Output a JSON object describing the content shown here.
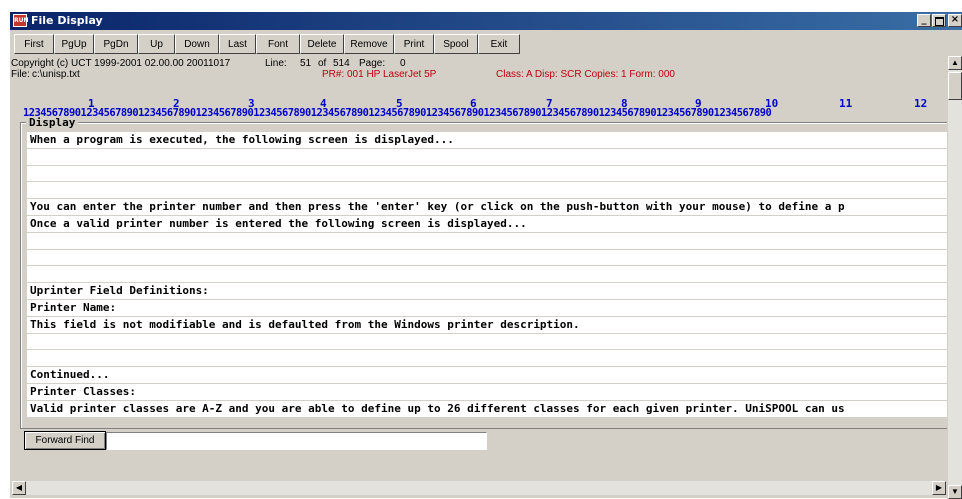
{
  "window": {
    "title": "File Display",
    "app_icon": "RUN",
    "controls": [
      "_",
      "\u0000",
      "X"
    ]
  },
  "toolbar": [
    {
      "label": "First"
    },
    {
      "label": "PgUp"
    },
    {
      "label": "PgDn"
    },
    {
      "label": "Up"
    },
    {
      "label": "Down"
    },
    {
      "label": "Last"
    },
    {
      "label": "Font"
    },
    {
      "label": "Delete"
    },
    {
      "label": "Remove"
    },
    {
      "label": "Print"
    },
    {
      "label": "Spool"
    },
    {
      "label": "Exit"
    }
  ],
  "header": {
    "copyright": "Copyright (c) UCT 1999-2001 02.00.00 20011017",
    "file_label": "File:",
    "file_path": "c:\\unisp.txt",
    "line_label": "Line:",
    "line_value": "51",
    "of_label": "of",
    "total_lines": "514",
    "page_label": "Page:",
    "page_value": "0",
    "printer_label": "PR#:",
    "printer_value": "001  HP LaserJet 5P",
    "class_info": "Class: A  Disp: SCR  Copies:  1  Form: 000"
  },
  "ruler": {
    "tens": [
      "1",
      "2",
      "3",
      "4",
      "5",
      "6",
      "7",
      "8",
      "9",
      "10",
      "11",
      "12"
    ],
    "digits": "1234567890123456789012345678901234567890123456789012345678901234567890123456789012345678901234567890123456789012345678901234567890"
  },
  "display": {
    "label": "Display",
    "lines": [
      "When a program is executed, the following screen is displayed...",
      "",
      "",
      "",
      "You can enter the printer number and then press the 'enter' key (or click on the push-button with your mouse) to define a p",
      "Once a valid printer number is entered the following screen is displayed...",
      "",
      "",
      "",
      "Uprinter Field Definitions:",
      "Printer Name:",
      "This field is not modifiable and is defaulted from the Windows printer description.",
      "",
      "",
      "Continued...",
      "Printer Classes:",
      "Valid printer classes are A-Z and you are able to define up to 26 different classes for each given printer. UniSPOOL can us"
    ]
  },
  "find": {
    "button_label": "Forward Find",
    "value": ""
  },
  "colors": {
    "title_bar": "#0a246a",
    "window_bg": "#d4d0c8",
    "ruler_text": "#0000c8",
    "printer_text": "#c0000e"
  },
  "icons": {
    "vscroll_up": "triangle-up-icon",
    "vscroll_down": "triangle-down-icon",
    "hscroll_left": "triangle-left-icon",
    "hscroll_right": "triangle-right-icon"
  }
}
